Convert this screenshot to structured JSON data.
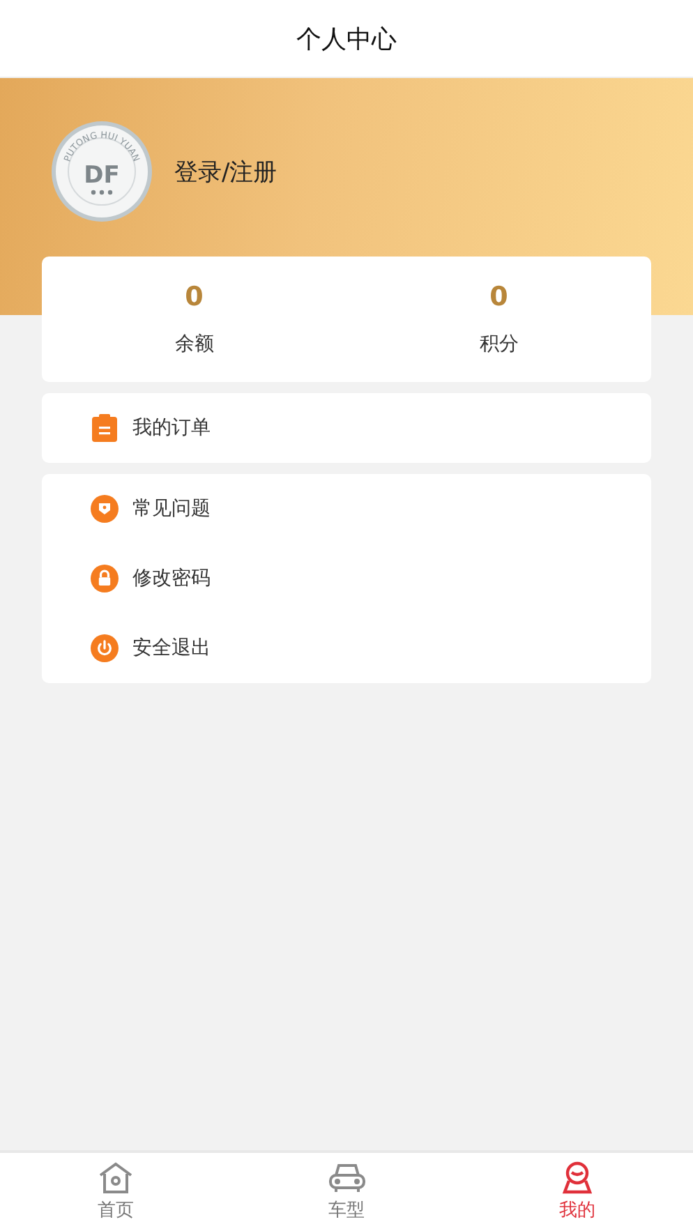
{
  "header": {
    "title": "个人中心"
  },
  "profile": {
    "badge_ring": "PUTONG HUI YUAN",
    "badge_mark": "DF",
    "login": "登录/注册"
  },
  "stats": [
    {
      "value": "0",
      "label": "余额"
    },
    {
      "value": "0",
      "label": "积分"
    }
  ],
  "menu_groups": [
    [
      {
        "kind": "order",
        "label": "我的订单"
      }
    ],
    [
      {
        "kind": "faq",
        "label": "常见问题"
      },
      {
        "kind": "password",
        "label": "修改密码"
      },
      {
        "kind": "logout",
        "label": "安全退出"
      }
    ]
  ],
  "tabs": [
    {
      "kind": "home",
      "label": "首页",
      "selected": false
    },
    {
      "kind": "car",
      "label": "车型",
      "selected": false
    },
    {
      "kind": "me",
      "label": "我的",
      "selected": true
    }
  ]
}
